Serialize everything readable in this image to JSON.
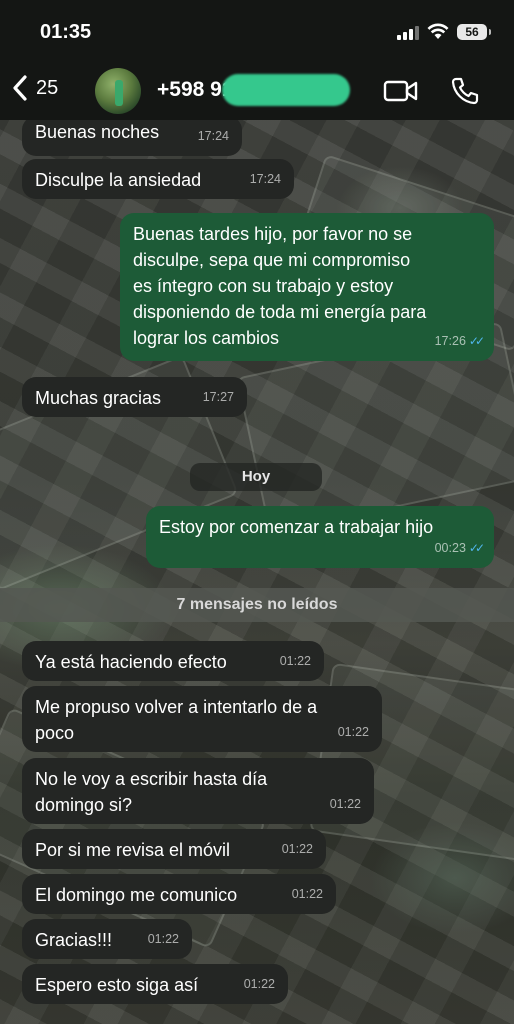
{
  "status_bar": {
    "time": "01:35",
    "battery": "56"
  },
  "header": {
    "back_count": "25",
    "contact_number": "+598 91 2",
    "icons": [
      "back-chevron-icon",
      "video-camera-icon",
      "phone-icon"
    ]
  },
  "colors": {
    "incoming_bubble": "#242624",
    "outgoing_bubble": "#1d5b37",
    "read_ticks": "#4fb6ec",
    "redaction": "#35c88d"
  },
  "messages_before": [
    {
      "direction": "in",
      "text": "Buenas noches",
      "time": "17:24"
    },
    {
      "direction": "in",
      "text": "Disculpe la ansiedad",
      "time": "17:24"
    },
    {
      "direction": "out",
      "lines": [
        "Buenas tardes hijo, por favor no se",
        "disculpe, sepa que mi compromiso",
        "es íntegro con su trabajo y estoy",
        "disponiendo de toda mi energía para",
        "lograr los cambios"
      ],
      "time": "17:26",
      "status": "read"
    },
    {
      "direction": "in",
      "text": "Muchas gracias",
      "time": "17:27"
    }
  ],
  "day_separator": "Hoy",
  "messages_today": [
    {
      "direction": "out",
      "text": "Estoy por comenzar a trabajar hijo",
      "time": "00:23",
      "status": "read"
    }
  ],
  "unread_label": "7 mensajes no leídos",
  "unread_messages": [
    {
      "direction": "in",
      "text": "Ya está haciendo efecto",
      "time": "01:22"
    },
    {
      "direction": "in",
      "lines": [
        "Me propuso volver a intentarlo de a",
        "poco"
      ],
      "time": "01:22"
    },
    {
      "direction": "in",
      "lines": [
        "No le voy a escribir hasta día",
        "domingo si?"
      ],
      "time": "01:22"
    },
    {
      "direction": "in",
      "text": "Por si me revisa el móvil",
      "time": "01:22"
    },
    {
      "direction": "in",
      "text": "El domingo me comunico",
      "time": "01:22"
    },
    {
      "direction": "in",
      "text": "Gracias!!!",
      "time": "01:22"
    },
    {
      "direction": "in",
      "text": "Espero esto siga así",
      "time": "01:22"
    }
  ]
}
